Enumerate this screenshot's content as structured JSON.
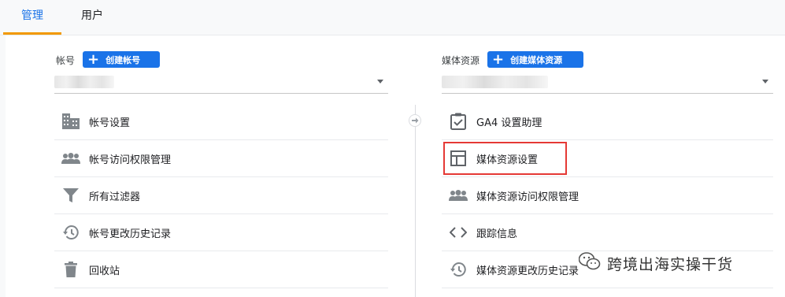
{
  "tabs": [
    {
      "label": "管理",
      "active": true
    },
    {
      "label": "用户",
      "active": false
    }
  ],
  "account": {
    "label": "帐号",
    "create_button": "创建帐号",
    "selector_value": "",
    "items": [
      {
        "icon": "building-icon",
        "label": "帐号设置"
      },
      {
        "icon": "people-icon",
        "label": "帐号访问权限管理"
      },
      {
        "icon": "filter-icon",
        "label": "所有过滤器"
      },
      {
        "icon": "history-icon",
        "label": "帐号更改历史记录"
      },
      {
        "icon": "trash-icon",
        "label": "回收站"
      }
    ]
  },
  "property": {
    "label": "媒体资源",
    "create_button": "创建媒体资源",
    "selector_value": "",
    "items": [
      {
        "icon": "checklist-icon",
        "label": "GA4 设置助理"
      },
      {
        "icon": "property-settings-icon",
        "label": "媒体资源设置"
      },
      {
        "icon": "people-icon",
        "label": "媒体资源访问权限管理"
      },
      {
        "icon": "code-icon",
        "label": "跟踪信息"
      },
      {
        "icon": "history-icon",
        "label": "媒体资源更改历史记录"
      }
    ]
  },
  "watermark": {
    "text": "跨境出海实操干货"
  },
  "colors": {
    "accent": "#1a73e8",
    "tab_indicator": "#f29900",
    "highlight": "#e53935"
  }
}
